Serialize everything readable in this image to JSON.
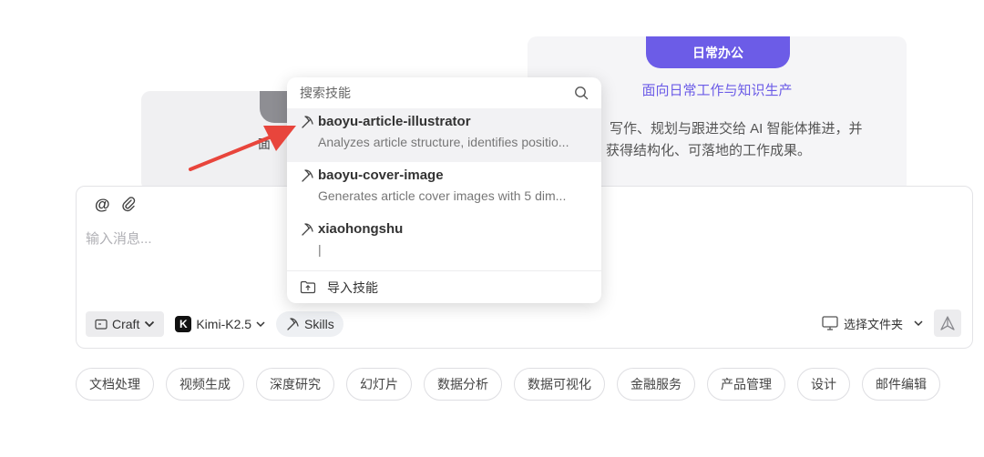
{
  "cards": {
    "daily": {
      "tab_label": "日常办公",
      "subtitle": "面向日常工作与知识生产",
      "desc_line1": "写作、规划与跟进交给 AI 智能体推进，并",
      "desc_line2": "获得结构化、可落地的工作成果。"
    },
    "left_peek": "面"
  },
  "popup": {
    "search_placeholder": "搜索技能",
    "skills": [
      {
        "name": "baoyu-article-illustrator",
        "description": "Analyzes article structure, identifies positio..."
      },
      {
        "name": "baoyu-cover-image",
        "description": "Generates article cover images with 5 dim..."
      },
      {
        "name": "xiaohongshu",
        "description": "|"
      }
    ],
    "import_label": "导入技能"
  },
  "composer": {
    "placeholder": "输入消息...",
    "mode_label": "Craft",
    "model_label": "Kimi-K2.5",
    "skills_label": "Skills",
    "folder_label": "选择文件夹"
  },
  "chips": [
    "文档处理",
    "视频生成",
    "深度研究",
    "幻灯片",
    "数据分析",
    "数据可视化",
    "金融服务",
    "产品管理",
    "设计",
    "邮件编辑"
  ],
  "colors": {
    "accent": "#6c5ce7",
    "arrow": "#e8453c"
  }
}
